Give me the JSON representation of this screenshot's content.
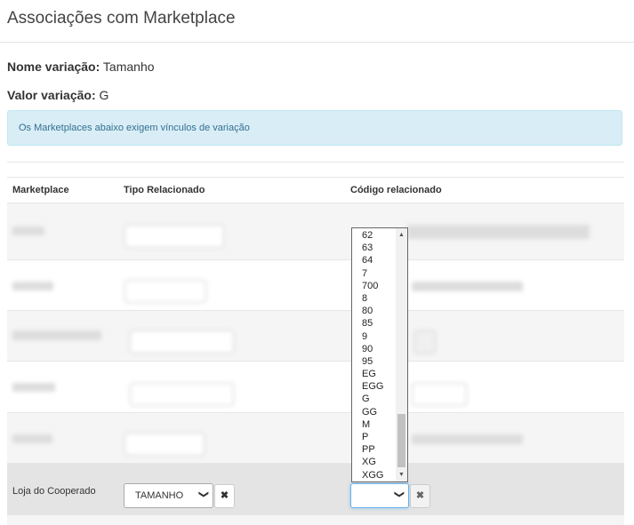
{
  "modal": {
    "title": "Associações com Marketplace"
  },
  "info": {
    "nome_variacao_label": "Nome variação:",
    "nome_variacao_value": "Tamanho",
    "valor_variacao_label": "Valor variação:",
    "valor_variacao_value": "G"
  },
  "alert": {
    "text": "Os Marketplaces abaixo exigem vínculos de variação"
  },
  "table": {
    "headers": {
      "marketplace": "Marketplace",
      "tipo": "Tipo Relacionado",
      "codigo": "Código relacionado"
    },
    "active_row": {
      "marketplace": "Loja do Cooperado",
      "tipo_value": "TAMANHO",
      "codigo_value": "",
      "remove_icon": "times-icon"
    }
  },
  "dropdown": {
    "options": [
      "62",
      "63",
      "64",
      "7",
      "700",
      "8",
      "80",
      "85",
      "9",
      "90",
      "95",
      "EG",
      "EGG",
      "G",
      "GG",
      "M",
      "P",
      "PP",
      "XG",
      "XGG"
    ],
    "scroll_up_icon": "arrow-up-icon",
    "scroll_down_icon": "arrow-down-icon"
  },
  "icons": {
    "select_chevron": "chevron-down-icon"
  },
  "colors": {
    "alert_bg": "#d9edf7",
    "alert_text": "#31708f",
    "highlight_row": "#e4e4e4"
  }
}
